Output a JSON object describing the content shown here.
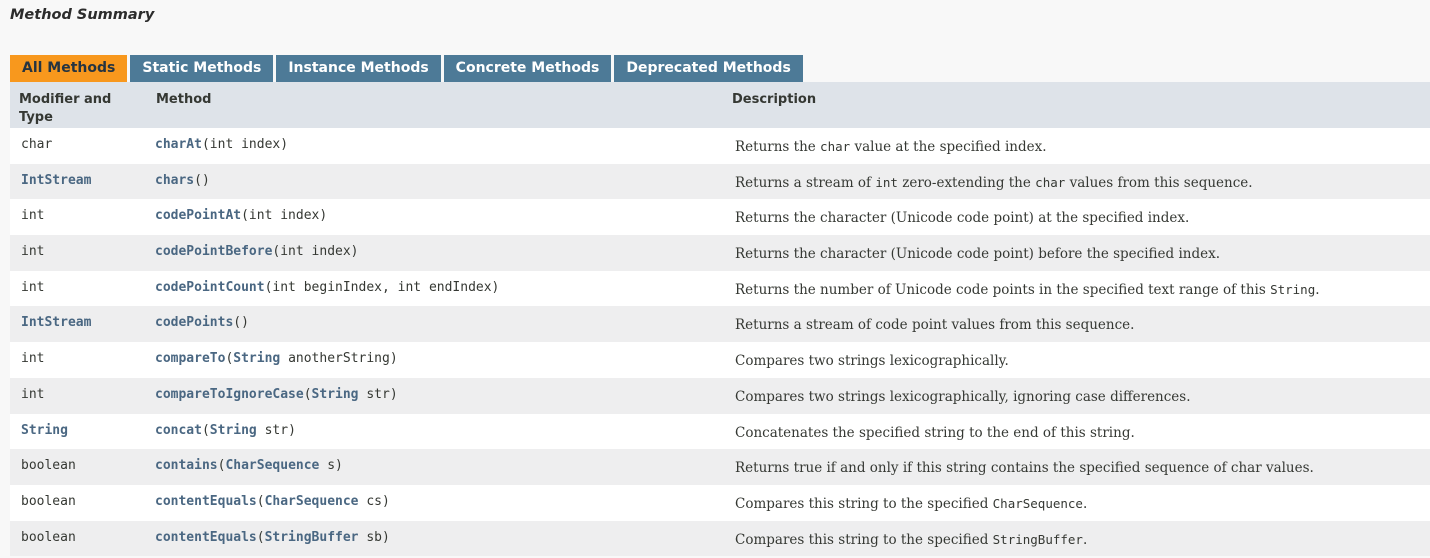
{
  "section_title": "Method Summary",
  "tabs": [
    {
      "label": "All Methods",
      "active": true
    },
    {
      "label": "Static Methods",
      "active": false
    },
    {
      "label": "Instance Methods",
      "active": false
    },
    {
      "label": "Concrete Methods",
      "active": false
    },
    {
      "label": "Deprecated Methods",
      "active": false
    }
  ],
  "columns": {
    "modifier": "Modifier and Type",
    "method": "Method",
    "description": "Description"
  },
  "colors": {
    "active_tab": "#f8981d",
    "tab": "#4d7a97",
    "header_bg": "#dee3e9",
    "row_alt": "#eeeeef",
    "link": "#4a6782"
  },
  "rows": [
    {
      "type": "char",
      "type_link": false,
      "name": "charAt",
      "params": [
        {
          "t": "(int index)"
        }
      ],
      "desc": [
        {
          "t": "Returns the "
        },
        {
          "c": "char"
        },
        {
          "t": " value at the specified index."
        }
      ]
    },
    {
      "type": "IntStream",
      "type_link": true,
      "name": "chars",
      "params": [
        {
          "t": "()"
        }
      ],
      "desc": [
        {
          "t": "Returns a stream of "
        },
        {
          "c": "int"
        },
        {
          "t": " zero-extending the "
        },
        {
          "c": "char"
        },
        {
          "t": " values from this sequence."
        }
      ]
    },
    {
      "type": "int",
      "type_link": false,
      "name": "codePointAt",
      "params": [
        {
          "t": "(int index)"
        }
      ],
      "desc": [
        {
          "t": "Returns the character (Unicode code point) at the specified index."
        }
      ]
    },
    {
      "type": "int",
      "type_link": false,
      "name": "codePointBefore",
      "params": [
        {
          "t": "(int index)"
        }
      ],
      "desc": [
        {
          "t": "Returns the character (Unicode code point) before the specified index."
        }
      ]
    },
    {
      "type": "int",
      "type_link": false,
      "name": "codePointCount",
      "params": [
        {
          "t": "(int beginIndex, int endIndex)"
        }
      ],
      "desc": [
        {
          "t": "Returns the number of Unicode code points in the specified text range of this "
        },
        {
          "c": "String"
        },
        {
          "t": "."
        }
      ]
    },
    {
      "type": "IntStream",
      "type_link": true,
      "name": "codePoints",
      "params": [
        {
          "t": "()"
        }
      ],
      "desc": [
        {
          "t": "Returns a stream of code point values from this sequence."
        }
      ]
    },
    {
      "type": "int",
      "type_link": false,
      "name": "compareTo",
      "params": [
        {
          "t": "("
        },
        {
          "l": "String"
        },
        {
          "t": " anotherString)"
        }
      ],
      "desc": [
        {
          "t": "Compares two strings lexicographically."
        }
      ]
    },
    {
      "type": "int",
      "type_link": false,
      "name": "compareToIgnoreCase",
      "params": [
        {
          "t": "("
        },
        {
          "l": "String"
        },
        {
          "t": " str)"
        }
      ],
      "desc": [
        {
          "t": "Compares two strings lexicographically, ignoring case differences."
        }
      ]
    },
    {
      "type": "String",
      "type_link": true,
      "name": "concat",
      "params": [
        {
          "t": "("
        },
        {
          "l": "String"
        },
        {
          "t": " str)"
        }
      ],
      "desc": [
        {
          "t": "Concatenates the specified string to the end of this string."
        }
      ]
    },
    {
      "type": "boolean",
      "type_link": false,
      "name": "contains",
      "params": [
        {
          "t": "("
        },
        {
          "l": "CharSequence"
        },
        {
          "t": " s)"
        }
      ],
      "desc": [
        {
          "t": "Returns true if and only if this string contains the specified sequence of char values."
        }
      ]
    },
    {
      "type": "boolean",
      "type_link": false,
      "name": "contentEquals",
      "params": [
        {
          "t": "("
        },
        {
          "l": "CharSequence"
        },
        {
          "t": " cs)"
        }
      ],
      "desc": [
        {
          "t": "Compares this string to the specified "
        },
        {
          "c": "CharSequence"
        },
        {
          "t": "."
        }
      ]
    },
    {
      "type": "boolean",
      "type_link": false,
      "name": "contentEquals",
      "params": [
        {
          "t": "("
        },
        {
          "l": "StringBuffer"
        },
        {
          "t": " sb)"
        }
      ],
      "desc": [
        {
          "t": "Compares this string to the specified "
        },
        {
          "c": "StringBuffer"
        },
        {
          "t": "."
        }
      ]
    }
  ]
}
